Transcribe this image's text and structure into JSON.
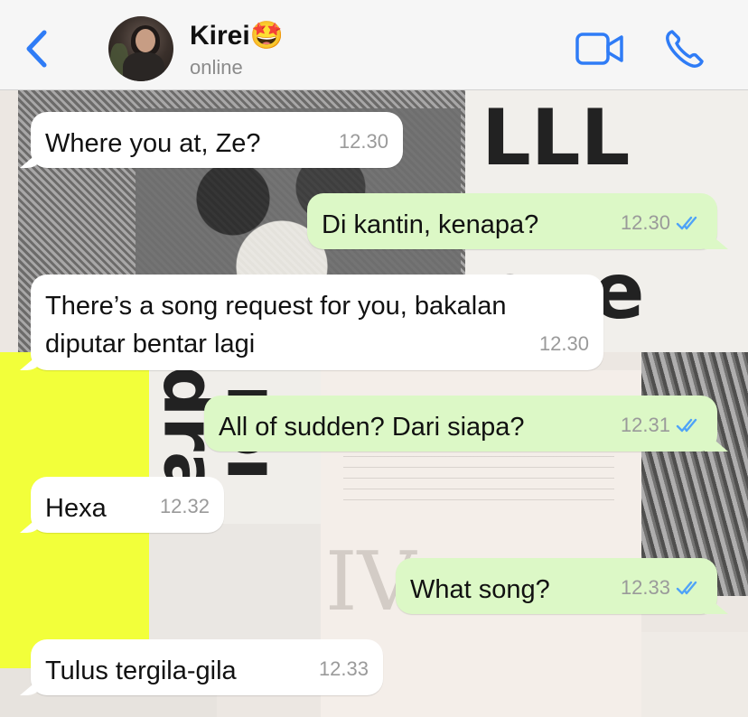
{
  "header": {
    "contact_name": "Kirei🤩",
    "status": "online"
  },
  "colors": {
    "accent": "#2f7cf6",
    "incoming_bubble": "#ffffff",
    "outgoing_bubble": "#dcf8c6",
    "read_ticks": "#4fa3f7"
  },
  "icons": {
    "back": "chevron-left-icon",
    "video": "video-camera-icon",
    "call": "phone-icon",
    "read": "double-check-icon"
  },
  "messages": [
    {
      "direction": "in",
      "text": "Where you at, Ze?",
      "time": "12.30"
    },
    {
      "direction": "out",
      "text": "Di kantin, kenapa?",
      "time": "12.30",
      "read": true
    },
    {
      "direction": "in",
      "text": "There’s a song request for you, bakalan",
      "text2": "diputar bentar lagi",
      "time": "12.30"
    },
    {
      "direction": "out",
      "text": "All of sudden? Dari siapa?",
      "time": "12.31",
      "read": true
    },
    {
      "direction": "in",
      "text": "Hexa",
      "time": "12.32"
    },
    {
      "direction": "out",
      "text": "What song?",
      "time": "12.33",
      "read": true
    },
    {
      "direction": "in",
      "text": "Tulus tergila-gila",
      "time": "12.33"
    }
  ]
}
